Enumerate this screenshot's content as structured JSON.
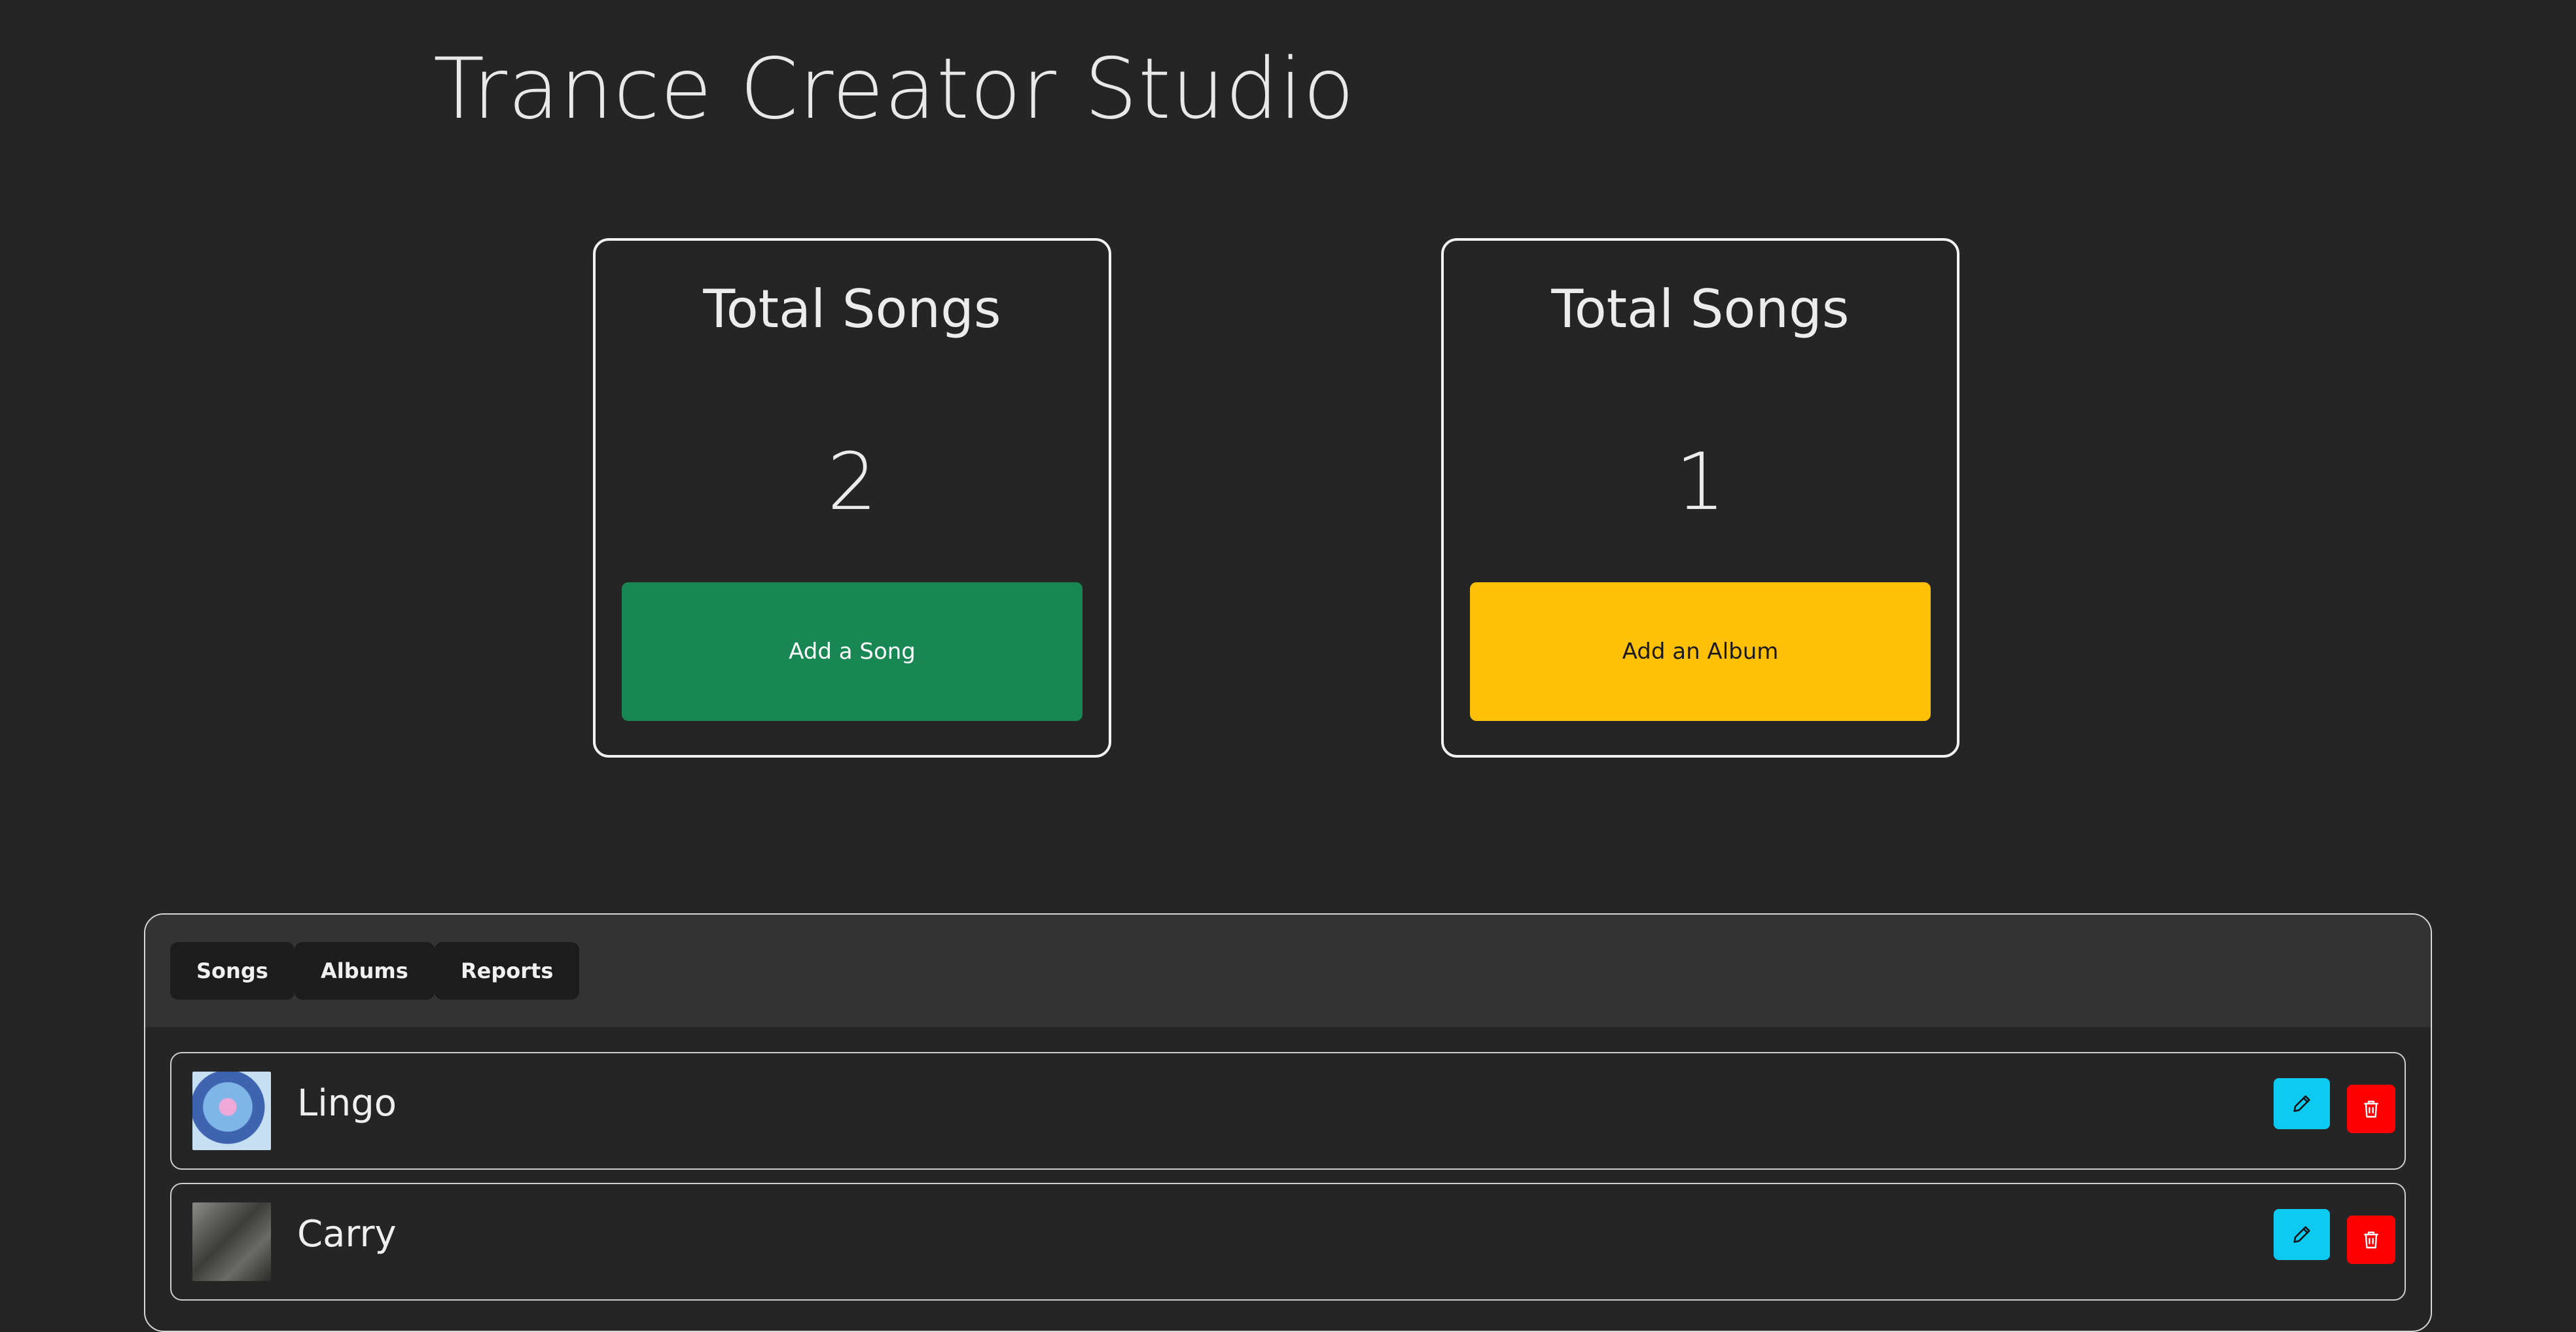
{
  "app": {
    "title": "Trance Creator Studio"
  },
  "stats": [
    {
      "title": "Total Songs",
      "value": "2",
      "button_label": "Add a Song"
    },
    {
      "title": "Total Songs",
      "value": "1",
      "button_label": "Add an Album"
    }
  ],
  "tabs": [
    {
      "label": "Songs"
    },
    {
      "label": "Albums"
    },
    {
      "label": "Reports"
    }
  ],
  "songs": [
    {
      "name": "Lingo",
      "cover_icon": "album-cover-image"
    },
    {
      "name": "Carry",
      "cover_icon": "album-cover-image"
    }
  ],
  "colors": {
    "background": "#252525",
    "add_song_button": "#198754",
    "add_album_button": "#ffc107",
    "edit_button": "#0dcaf0",
    "delete_button": "#ff0000",
    "tab_bar": "#333333"
  },
  "icons": {
    "edit": "pencil-icon",
    "delete": "trash-icon"
  }
}
